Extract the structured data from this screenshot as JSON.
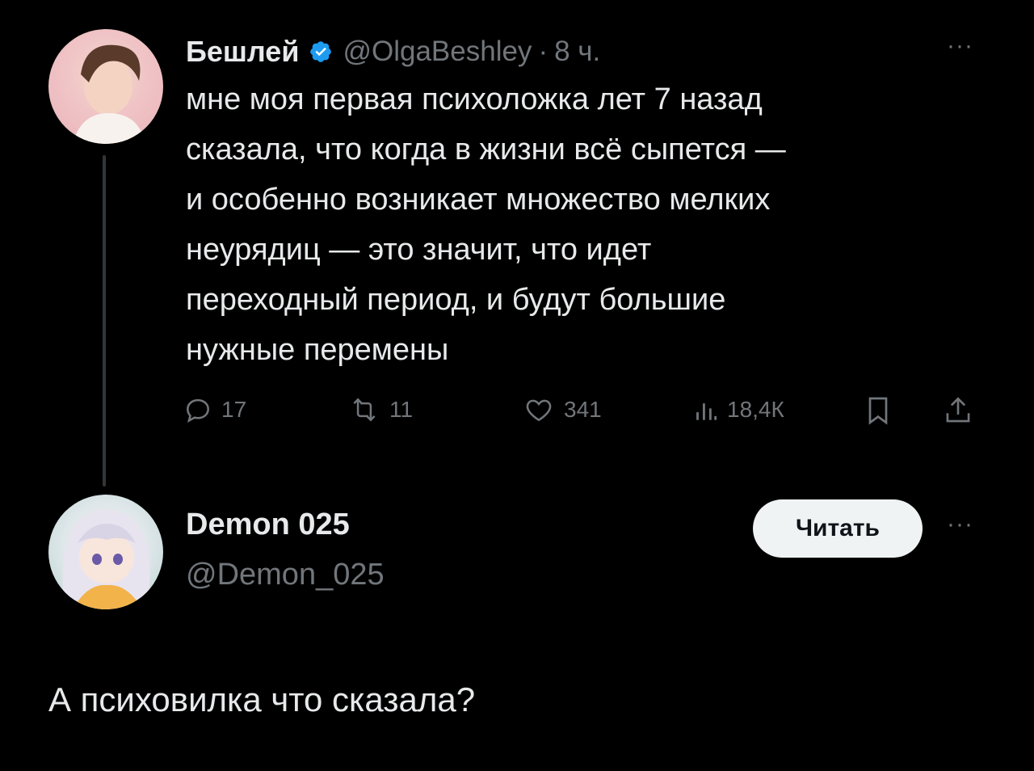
{
  "tweet": {
    "author_name": "Бешлей",
    "handle": "@OlgaBeshley",
    "separator": "·",
    "time": "8 ч.",
    "more_label": "···",
    "text": "мне моя первая психоложка лет 7 назад\nсказала, что когда в жизни всё сыпется —\nи особенно возникает множество мелких\nнеурядиц — это значит, что идет\nпереходный период, и будут большие\nнужные перемены",
    "actions": {
      "replies": "17",
      "reposts": "11",
      "likes": "341",
      "views": "18,4К"
    }
  },
  "profile": {
    "name": "Demon 025",
    "handle": "@Demon_025",
    "follow_label": "Читать",
    "more_label": "···"
  },
  "reply": {
    "text": "А психовилка что сказала?"
  },
  "colors": {
    "background": "#000000",
    "text": "#e7e9ea",
    "muted": "#71767b",
    "verified": "#1d9bf0"
  }
}
